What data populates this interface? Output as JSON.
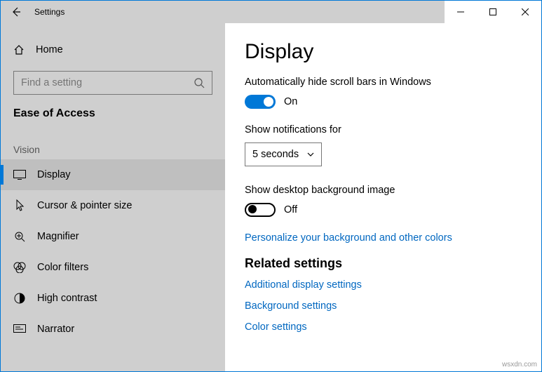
{
  "window": {
    "title": "Settings"
  },
  "sidebar": {
    "home_label": "Home",
    "search_placeholder": "Find a setting",
    "category": "Ease of Access",
    "group": "Vision",
    "items": [
      {
        "label": "Display",
        "icon": "display-icon",
        "active": true
      },
      {
        "label": "Cursor & pointer size",
        "icon": "cursor-icon",
        "active": false
      },
      {
        "label": "Magnifier",
        "icon": "magnifier-icon",
        "active": false
      },
      {
        "label": "Color filters",
        "icon": "color-filters-icon",
        "active": false
      },
      {
        "label": "High contrast",
        "icon": "high-contrast-icon",
        "active": false
      },
      {
        "label": "Narrator",
        "icon": "narrator-icon",
        "active": false
      }
    ]
  },
  "main": {
    "heading": "Display",
    "auto_hide_label": "Automatically hide scroll bars in Windows",
    "auto_hide_state": "On",
    "auto_hide_on": true,
    "notifications_label": "Show notifications for",
    "notifications_value": "5 seconds",
    "desktop_bg_label": "Show desktop background image",
    "desktop_bg_state": "Off",
    "desktop_bg_on": false,
    "personalize_link": "Personalize your background and other colors",
    "related_heading": "Related settings",
    "links": [
      "Additional display settings",
      "Background settings",
      "Color settings"
    ]
  },
  "watermark": "wsxdn.com"
}
